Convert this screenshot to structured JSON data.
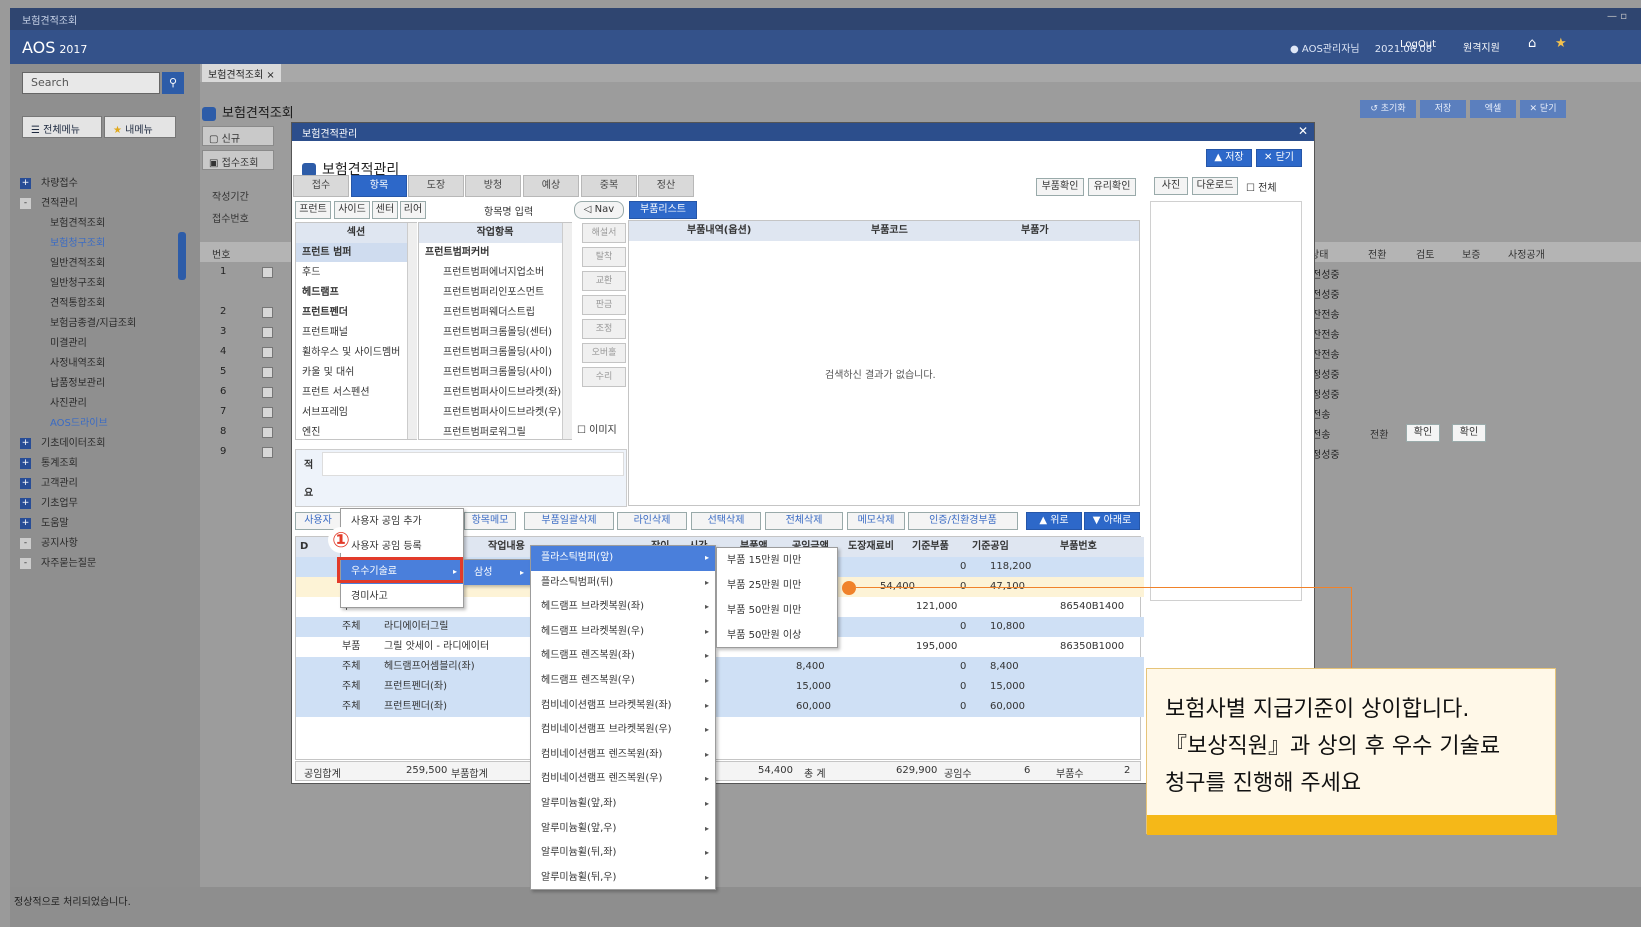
{
  "window": {
    "title": "보험견적조회"
  },
  "app": {
    "logo": "AOS",
    "year": "2017",
    "user": "AOS관리자님",
    "date": "2021.06.08",
    "logout": "LogOut",
    "remote": "원격지원"
  },
  "sidebar": {
    "search_placeholder": "Search",
    "tab_all": "전체메뉴",
    "tab_mine": "내메뉴",
    "items": [
      "차량접수",
      "견적관리",
      "보험견적조회",
      "보험청구조회",
      "일반견적조회",
      "일반청구조회",
      "견적통합조회",
      "보험금종결/지급조회",
      "미결관리",
      "사정내역조회",
      "납품정보관리",
      "사진관리",
      "AOS드라이브",
      "기초데이터조회",
      "통계조회",
      "고객관리",
      "기초업무",
      "도움말",
      "공지사항",
      "자주묻는질문"
    ]
  },
  "page": {
    "tab": "보험견적조회",
    "heading": "보험견적조회",
    "new": "신규",
    "receipt": "접수조회",
    "period_label": "작성기간",
    "receipt_no": "접수번호",
    "btn_reset": "초기화",
    "btn_save": "저장",
    "btn_excel": "엑셀",
    "btn_close": "닫기",
    "bg_headers": [
      "번호",
      "상태",
      "전환",
      "검토",
      "보증",
      "사정공개"
    ],
    "bg_nums": [
      "1",
      "2",
      "3",
      "4",
      "5",
      "6",
      "7",
      "8",
      "9"
    ],
    "bg_status": [
      "전성중",
      "전성중",
      "잔전송",
      "잔전송",
      "잔전송",
      "정성중",
      "정성중",
      "전송",
      "전송",
      "정성중"
    ],
    "bg_row8": [
      "전환",
      "확인",
      "확인"
    ]
  },
  "modal": {
    "title": "보험견적관리",
    "heading": "보험견적관리",
    "save": "저장",
    "close": "닫기",
    "tabs": [
      "접수",
      "항목",
      "도장",
      "방청",
      "예상",
      "중복",
      "정산"
    ],
    "part_check": "부품확인",
    "glass_check": "유리확인",
    "photo": "사진",
    "download": "다운로드",
    "all": "전체",
    "sub_tabs": [
      "프런트",
      "사이드",
      "센터",
      "리어"
    ],
    "item_input": "항목명 입력",
    "nav": "Nav",
    "parts_list": "부품리스트",
    "section_header": "섹션",
    "work_header": "작업항목",
    "sections": [
      "프런트 범퍼",
      "후드",
      "헤드램프",
      "프런트펜더",
      "프런트패널",
      "휠하우스 및 사이드멤버",
      "카울 및 대쉬",
      "프런트 서스펜션",
      "서브프레임",
      "엔진"
    ],
    "work_items": [
      "프런트범퍼커버",
      "프런트범퍼에너지업소버",
      "프런트범퍼리인포스먼트",
      "프런트범퍼웨더스트립",
      "프런트범퍼크롬몰딩(센터)",
      "프런트범퍼크롬몰딩(사이)",
      "프런트범퍼크롬몰딩(사이)",
      "프런트범퍼사이드브라켓(좌)",
      "프런트범퍼사이드브라켓(우)",
      "프런트범퍼로워그릴"
    ],
    "side_buttons": [
      "해설서",
      "탈착",
      "교환",
      "판금",
      "조정",
      "오버홀",
      "수리"
    ],
    "image_check": "이미지",
    "parts_headers": [
      "부품내역(옵션)",
      "부품코드",
      "부품가"
    ],
    "no_result": "검색하신 결과가 없습니다.",
    "memo_label1": "적",
    "memo_label2": "요",
    "toolbar": [
      "사용자",
      "항목메모",
      "부품일괄삭제",
      "라인삭제",
      "선택삭제",
      "전체삭제",
      "메모삭제",
      "인증/친환경부품"
    ],
    "up": "위로",
    "down": "아래로",
    "grid_headers": [
      "D",
      "작업내용",
      "장이",
      "시간",
      "부품액",
      "공임금액",
      "도장재료비",
      "기준부품",
      "기준공임",
      "부품번호"
    ],
    "grid_rows": [
      {
        "type": "",
        "name": "",
        "ap": "",
        "ac": "",
        "b1": "0",
        "b2": "118,200",
        "no": ""
      },
      {
        "type": "",
        "name": "",
        "ap": "",
        "ac": "54,400",
        "b1": "0",
        "b2": "47,100",
        "no": ""
      },
      {
        "type": "부",
        "name": "",
        "ap": "",
        "ac": "",
        "b1": "121,000",
        "b2": "",
        "no": "86540B1400"
      },
      {
        "type": "주체",
        "name": "라디에이터그릴",
        "ap": "",
        "ac": "",
        "b1": "0",
        "b2": "10,800",
        "no": ""
      },
      {
        "type": "부품",
        "name": "그릴 앗세이 - 라디에이터",
        "ap": "",
        "ac": "",
        "b1": "195,000",
        "b2": "",
        "no": "86350B1000"
      },
      {
        "type": "주체",
        "name": "헤드램프어셈블리(좌)",
        "ap": "8,400",
        "ac": "",
        "b1": "0",
        "b2": "8,400",
        "no": ""
      },
      {
        "type": "주체",
        "name": "프런트펜더(좌)",
        "ap": "15,000",
        "ac": "",
        "b1": "0",
        "b2": "15,000",
        "no": ""
      },
      {
        "type": "주체",
        "name": "프런트펜더(좌)",
        "ap": "60,000",
        "ac": "",
        "b1": "0",
        "b2": "60,000",
        "no": ""
      }
    ],
    "footer": {
      "labor_label": "공임합계",
      "labor_val": "259,500",
      "parts_label": "부품합계",
      "paint_val": "54,400",
      "total_label": "총 계",
      "total_val": "629,900",
      "labor_count_label": "공임수",
      "labor_count": "6",
      "parts_count_label": "부품수",
      "parts_count": "2"
    }
  },
  "ctx1": {
    "items": [
      "사용자 공임 추가",
      "사용자 공임 등록",
      "우수기술료",
      "경미사고"
    ]
  },
  "ctx2": {
    "item": "삼성"
  },
  "ctx3": {
    "items": [
      "플라스틱범퍼(앞)",
      "플라스틱범퍼(뒤)",
      "헤드램프 브라켓복원(좌)",
      "헤드램프 브라켓복원(우)",
      "헤드램프 렌즈복원(좌)",
      "헤드램프 렌즈복원(우)",
      "컴비네이션램프 브라켓복원(좌)",
      "컴비네이션램프 브라켓복원(우)",
      "컴비네이션램프 렌즈복원(좌)",
      "컴비네이션램프 렌즈복원(우)",
      "알루미늄휠(앞,좌)",
      "알루미늄휠(앞,우)",
      "알루미늄휠(뒤,좌)",
      "알루미늄휠(뒤,우)"
    ]
  },
  "ctx4": {
    "items": [
      "부품 15만원 미만",
      "부품 25만원 미만",
      "부품 50만원 미만",
      "부품 50만원 이상"
    ]
  },
  "marker": "①",
  "callout": {
    "line1": "보험사별 지급기준이 상이합니다.",
    "line2": "『보상직원』과 상의 후 우수 기술료",
    "line3": "청구를 진행해 주세요"
  },
  "status": {
    "text": "정상적으로 처리되었습니다."
  },
  "colors": {
    "accent": "#2d68c9",
    "callout_bar": "#f5b818",
    "highlight_border": "#e23b2a",
    "pointer": "#f0822a"
  }
}
